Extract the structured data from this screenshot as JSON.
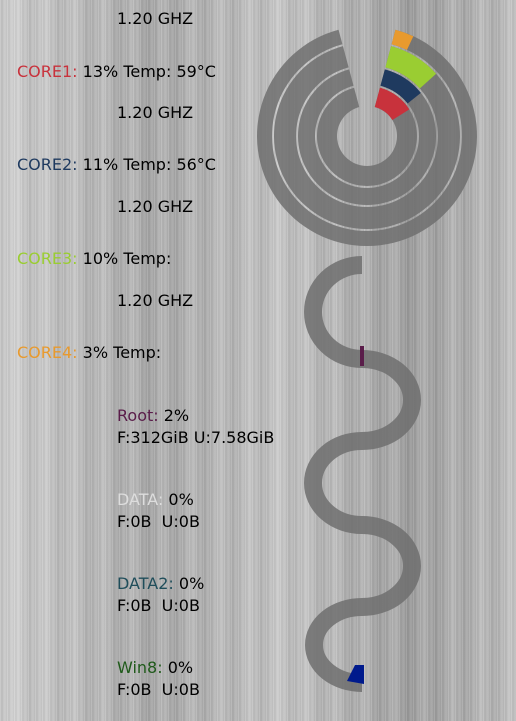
{
  "colors": {
    "core1": "#c8323c",
    "core2": "#1f3a5f",
    "core3": "#9acd32",
    "core4": "#e89a2e",
    "root": "#5a1d4a",
    "data": "#dddddd",
    "data2": "#1f4d5a",
    "win8": "#1f5a1a",
    "track": "#6e6e6e",
    "win8_fill": "#001a8c"
  },
  "cores": [
    {
      "freq": "1.20 GHZ",
      "label": "CORE1:",
      "usage": "13%",
      "temp_label": "Temp:",
      "temp": "59°C",
      "percent": 13
    },
    {
      "freq": "1.20 GHZ",
      "label": "CORE2:",
      "usage": "11%",
      "temp_label": "Temp:",
      "temp": "56°C",
      "percent": 11
    },
    {
      "freq": "1.20 GHZ",
      "label": "CORE3:",
      "usage": "10%",
      "temp_label": "Temp:",
      "temp": "",
      "percent": 10
    },
    {
      "freq": "1.20 GHZ",
      "label": "CORE4:",
      "usage": "3%",
      "temp_label": "Temp:",
      "temp": "",
      "percent": 3
    }
  ],
  "drives": [
    {
      "label": "Root:",
      "usage": "2%",
      "stats": "F:312GiB U:7.58GiB",
      "percent": 2
    },
    {
      "label": "DATA:",
      "usage": "0%",
      "stats": "F:0B  U:0B",
      "percent": 0
    },
    {
      "label": "DATA2:",
      "usage": "0%",
      "stats": "F:0B  U:0B",
      "percent": 0
    },
    {
      "label": "Win8:",
      "usage": "0%",
      "stats": "F:0B  U:0B",
      "percent": 0
    }
  ]
}
